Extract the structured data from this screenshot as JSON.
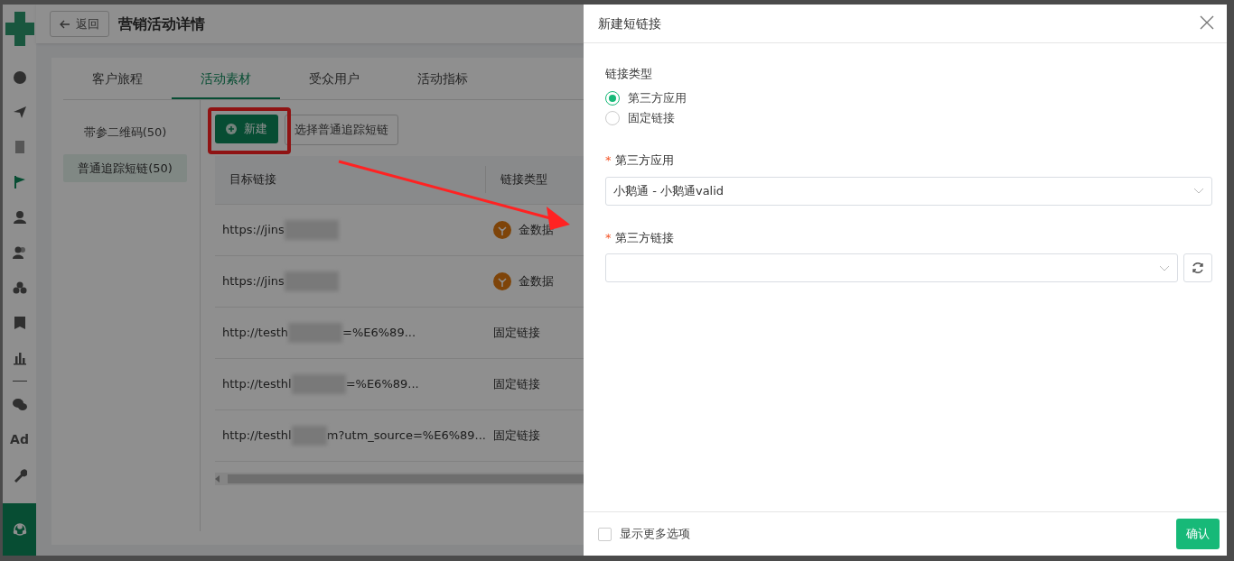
{
  "sidebar": {
    "items": [
      {
        "kind": "icon",
        "selected": false
      },
      {
        "kind": "icon",
        "selected": false
      },
      {
        "kind": "icon",
        "selected": false
      },
      {
        "kind": "icon",
        "selected": true
      },
      {
        "kind": "icon",
        "selected": false
      },
      {
        "kind": "icon",
        "selected": false
      },
      {
        "kind": "icon",
        "selected": false
      },
      {
        "kind": "icon",
        "selected": false
      },
      {
        "kind": "icon",
        "selected": false
      },
      {
        "kind": "divider",
        "selected": false
      },
      {
        "kind": "icon",
        "selected": false
      },
      {
        "kind": "text",
        "label": "Ad",
        "selected": false
      },
      {
        "kind": "icon",
        "selected": false
      }
    ]
  },
  "header": {
    "back_button": "返回",
    "title": "营销活动详情"
  },
  "tabs": [
    {
      "label": "客户旅程",
      "selected": false
    },
    {
      "label": "活动素材",
      "selected": true
    },
    {
      "label": "受众用户",
      "selected": false
    },
    {
      "label": "活动指标",
      "selected": false
    }
  ],
  "subnav": [
    {
      "label": "带参二维码(50)",
      "selected": false
    },
    {
      "label": "普通追踪短链(50)",
      "selected": true
    }
  ],
  "toolbar": {
    "new_button": "新建",
    "select_button": "选择普通追踪短链"
  },
  "table": {
    "columns": [
      "目标链接",
      "链接类型"
    ],
    "rows": [
      {
        "link_parts": [
          "https://jins"
        ],
        "kind": "app",
        "type": "金数据"
      },
      {
        "link_parts": [
          "https://jins"
        ],
        "kind": "app",
        "type": "金数据"
      },
      {
        "link_parts": [
          "http://testh",
          "=%E6%89..."
        ],
        "kind": "fixed",
        "type": "固定链接"
      },
      {
        "link_parts": [
          "http://testhl",
          "=%E6%89..."
        ],
        "kind": "fixed",
        "type": "固定链接"
      },
      {
        "link_parts": [
          "http://testhl",
          "m?utm_source=%E6%89..."
        ],
        "kind": "fixed",
        "type": "固定链接"
      }
    ]
  },
  "drawer": {
    "title": "新建短链接",
    "type_label": "链接类型",
    "radios": [
      {
        "label": "第三方应用",
        "selected": true
      },
      {
        "label": "固定链接",
        "selected": false
      }
    ],
    "fields": [
      {
        "label": "第三方应用",
        "required_mark": "*",
        "value": "小鹅通 - 小鹅通valid",
        "refresh": false
      },
      {
        "label": "第三方链接",
        "required_mark": "*",
        "refresh": true
      }
    ],
    "more_options": {
      "label": "显示更多选项",
      "checked": false
    },
    "confirm_button": "确认"
  }
}
